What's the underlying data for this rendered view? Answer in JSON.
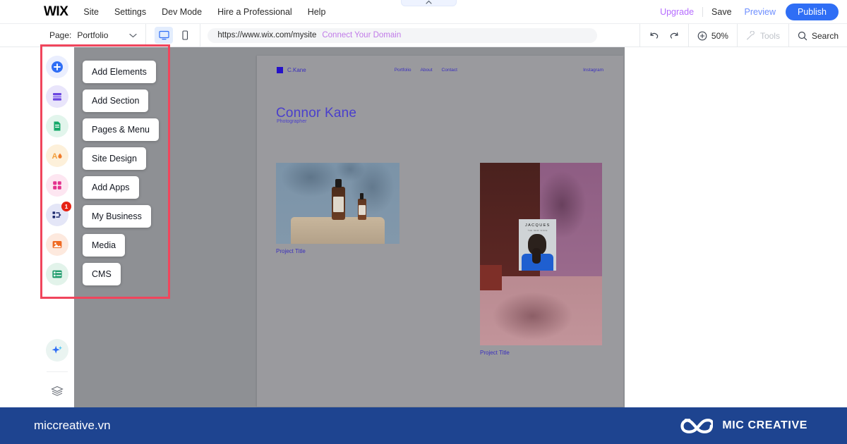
{
  "topbar": {
    "logo": "WIX",
    "menu": [
      {
        "label": "Site",
        "name": "site"
      },
      {
        "label": "Settings",
        "name": "settings"
      },
      {
        "label": "Dev Mode",
        "name": "dev-mode"
      },
      {
        "label": "Hire a Professional",
        "name": "hire-a-professional"
      },
      {
        "label": "Help",
        "name": "help"
      }
    ],
    "upgrade": "Upgrade",
    "save": "Save",
    "preview": "Preview",
    "publish": "Publish",
    "collapse_icon": "chevron-up-icon",
    "accent_publish": "#2f6ef5",
    "accent_upgrade": "#b66dff",
    "accent_preview": "#6d8eff"
  },
  "secondbar": {
    "page_label": "Page:",
    "page_value": "Portfolio",
    "page_caret": "chevron-down-icon",
    "desktop_icon": "desktop-icon",
    "mobile_icon": "mobile-icon",
    "url": "https://www.wix.com/mysite",
    "connect_domain": "Connect Your Domain",
    "undo_icon": "undo-icon",
    "redo_icon": "redo-icon",
    "zoom_icon": "zoom-in-icon",
    "zoom_level": "50%",
    "tools_icon": "tools-icon",
    "tools_label": "Tools",
    "search_icon": "search-icon",
    "search_label": "Search"
  },
  "rail": {
    "items": [
      {
        "name": "add-icon",
        "label": "Add",
        "bg": "#eaeefe",
        "fg": "#2f6ef5",
        "badge": ""
      },
      {
        "name": "add-section-icon",
        "label": "Add Section",
        "bg": "#e9e5fb",
        "fg": "#6b46e0",
        "badge": ""
      },
      {
        "name": "pages-icon",
        "label": "Pages & Menu",
        "bg": "#e2f5ec",
        "fg": "#16a96a",
        "badge": ""
      },
      {
        "name": "site-design-icon",
        "label": "Site Design",
        "bg": "#fdf0da",
        "fg": "#f2a03d",
        "badge": ""
      },
      {
        "name": "add-apps-icon",
        "label": "Add Apps",
        "bg": "#fde6f1",
        "fg": "#e4318d",
        "badge": ""
      },
      {
        "name": "my-business-icon",
        "label": "My Business",
        "bg": "#e4e6f7",
        "fg": "#1f2b6e",
        "badge": "1"
      },
      {
        "name": "media-icon",
        "label": "Media",
        "bg": "#fde9de",
        "fg": "#ef6a23",
        "badge": ""
      },
      {
        "name": "cms-icon",
        "label": "CMS",
        "bg": "#e2f3ea",
        "fg": "#1f9c6c",
        "badge": ""
      }
    ],
    "bottom": [
      {
        "name": "ai-sparkle-icon",
        "label": "AI Assistant",
        "bg": "#e9f3f0",
        "fg": "#2f6ef5"
      },
      {
        "name": "layers-icon",
        "label": "Layers",
        "bg": "#ffffff",
        "fg": "#6b7078"
      }
    ]
  },
  "menu_panel": {
    "buttons": [
      {
        "label": "Add Elements",
        "name": "add-elements"
      },
      {
        "label": "Add Section",
        "name": "add-section"
      },
      {
        "label": "Pages & Menu",
        "name": "pages-and-menu"
      },
      {
        "label": "Site Design",
        "name": "site-design"
      },
      {
        "label": "Add Apps",
        "name": "add-apps"
      },
      {
        "label": "My Business",
        "name": "my-business"
      },
      {
        "label": "Media",
        "name": "media"
      },
      {
        "label": "CMS",
        "name": "cms"
      }
    ]
  },
  "site_preview": {
    "brand": "C.Kane",
    "nav": [
      "Portfolio",
      "About",
      "Contact"
    ],
    "social": "Instagram",
    "hero_title": "Connor Kane",
    "hero_subtitle": "Photographer",
    "projects": [
      {
        "caption": "Project Title",
        "name": "project-1"
      },
      {
        "caption": "Project Title",
        "name": "project-2"
      }
    ],
    "magazine_title": "JACQUES",
    "magazine_subtitle": "THE NEW ISSUE"
  },
  "highlight": {
    "color": "#f0455c"
  },
  "footer": {
    "site": "miccreative.vn",
    "brand_name": "MIC CREATIVE",
    "logo_icon": "infinity-loop-icon",
    "bg": "#1e4490"
  }
}
